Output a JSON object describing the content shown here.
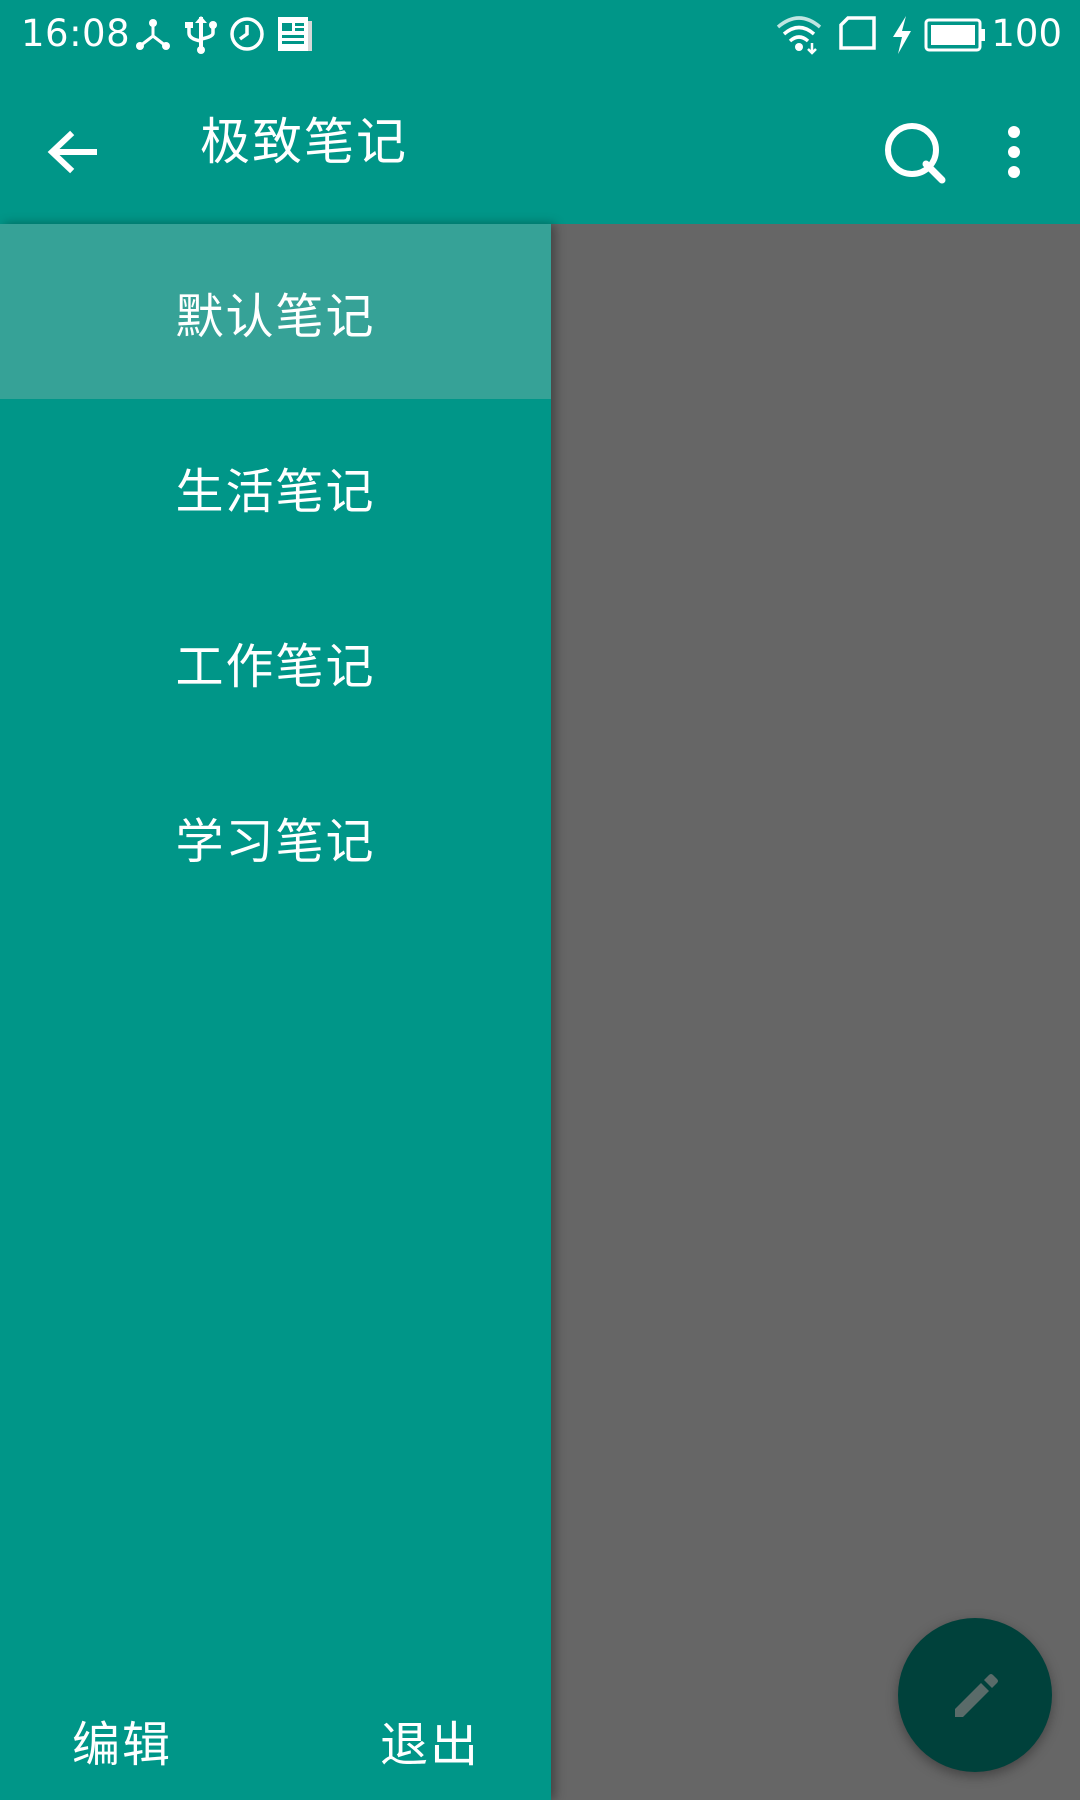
{
  "status_bar": {
    "time": "16:08",
    "battery_percent": "100",
    "icons": [
      "usb-tether-icon",
      "usb-icon",
      "alarm-icon",
      "notification-news-icon",
      "wifi-icon",
      "sim-card-icon",
      "charging-icon",
      "battery-icon"
    ]
  },
  "app_bar": {
    "title": "极致笔记",
    "back_icon": "arrow-back-icon",
    "search_icon": "search-icon",
    "more_icon": "more-vert-icon"
  },
  "drawer": {
    "items": [
      {
        "label": "默认笔记",
        "selected": true
      },
      {
        "label": "生活笔记",
        "selected": false
      },
      {
        "label": "工作笔记",
        "selected": false
      },
      {
        "label": "学习笔记",
        "selected": false
      }
    ],
    "footer": {
      "edit_label": "编辑",
      "exit_label": "退出"
    }
  },
  "fab": {
    "icon": "pencil-icon"
  },
  "colors": {
    "primary": "#009688",
    "selected_item": "#36A297",
    "scrim": "#666666",
    "fab": "#00413B",
    "text": "#FFFFFF"
  }
}
